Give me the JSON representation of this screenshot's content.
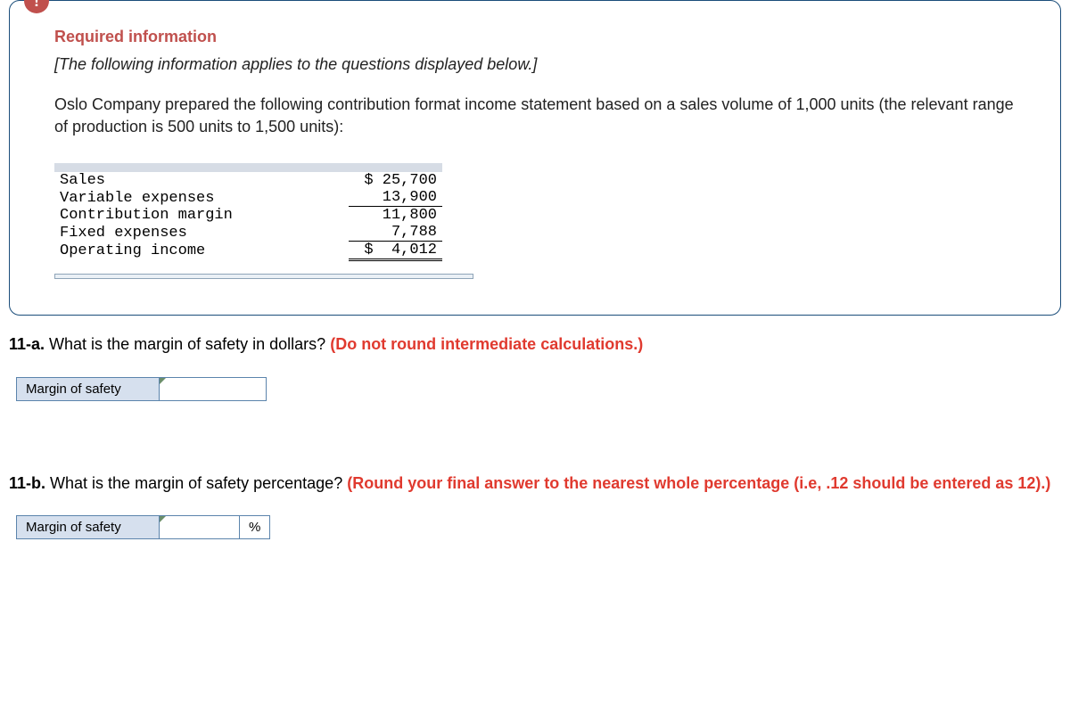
{
  "alert_symbol": "!",
  "required_heading": "Required information",
  "italic_note": "[The following information applies to the questions displayed below.]",
  "body_text": "Oslo Company prepared the following contribution format income statement based on a sales volume of 1,000 units (the relevant range of production is 500 units to 1,500 units):",
  "income": {
    "rows": [
      {
        "label": "Sales",
        "currency": "$",
        "value": "25,700",
        "cls": ""
      },
      {
        "label": "Variable expenses",
        "currency": "",
        "value": "13,900",
        "cls": "underline-single"
      },
      {
        "label": "Contribution margin",
        "currency": "",
        "value": "11,800",
        "cls": ""
      },
      {
        "label": "Fixed expenses",
        "currency": "",
        "value": "7,788",
        "cls": "underline-single"
      },
      {
        "label": "Operating income",
        "currency": "$",
        "value": "4,012",
        "cls": "double-bottom underline-double-top"
      }
    ]
  },
  "q11a": {
    "prefix": "11-a.",
    "text": " What is the margin of safety in dollars? ",
    "red": "(Do not round intermediate calculations.)",
    "label": "Margin of safety"
  },
  "q11b": {
    "prefix": "11-b.",
    "text": " What is the margin of safety percentage? ",
    "red": "(Round your final answer to the nearest whole percentage (i.e, .12 should be entered as 12).)",
    "label": "Margin of safety",
    "unit": "%"
  }
}
